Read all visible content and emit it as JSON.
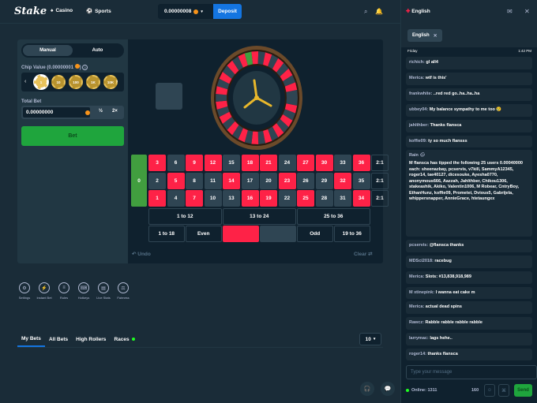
{
  "header": {
    "logo": "Stake",
    "nav": [
      {
        "label": "Casino",
        "icon": "casino-icon"
      },
      {
        "label": "Sports",
        "icon": "sports-icon"
      }
    ],
    "balance": "0.00000008",
    "deposit_label": "Deposit",
    "icons": [
      "search-icon",
      "bell-icon"
    ]
  },
  "game": {
    "tabs": [
      "Manual",
      "Auto"
    ],
    "chip_value_label": "Chip Value (0.00000001",
    "chip_value_info": "i",
    "chips": [
      "1",
      "10",
      "100",
      "1K",
      "10K"
    ],
    "total_bet_label": "Total Bet",
    "total_bet_value": "0.00000000",
    "half_label": "½",
    "double_label": "2×",
    "bet_button": "Bet",
    "undo_label": "Undo",
    "clear_label": "Clear",
    "zero": "0",
    "numbers_top": [
      {
        "n": "3",
        "c": "red"
      },
      {
        "n": "6",
        "c": "black"
      },
      {
        "n": "9",
        "c": "red"
      },
      {
        "n": "12",
        "c": "red"
      },
      {
        "n": "15",
        "c": "black"
      },
      {
        "n": "18",
        "c": "red"
      },
      {
        "n": "21",
        "c": "red"
      },
      {
        "n": "24",
        "c": "black"
      },
      {
        "n": "27",
        "c": "red"
      },
      {
        "n": "30",
        "c": "red"
      },
      {
        "n": "33",
        "c": "black"
      },
      {
        "n": "36",
        "c": "red"
      }
    ],
    "numbers_mid": [
      {
        "n": "2",
        "c": "black"
      },
      {
        "n": "5",
        "c": "red"
      },
      {
        "n": "8",
        "c": "black"
      },
      {
        "n": "11",
        "c": "black"
      },
      {
        "n": "14",
        "c": "red"
      },
      {
        "n": "17",
        "c": "black"
      },
      {
        "n": "20",
        "c": "black"
      },
      {
        "n": "23",
        "c": "red"
      },
      {
        "n": "26",
        "c": "black"
      },
      {
        "n": "29",
        "c": "black"
      },
      {
        "n": "32",
        "c": "red"
      },
      {
        "n": "35",
        "c": "black"
      }
    ],
    "numbers_bot": [
      {
        "n": "1",
        "c": "red"
      },
      {
        "n": "4",
        "c": "black"
      },
      {
        "n": "7",
        "c": "red"
      },
      {
        "n": "10",
        "c": "black"
      },
      {
        "n": "13",
        "c": "black"
      },
      {
        "n": "16",
        "c": "red"
      },
      {
        "n": "19",
        "c": "red"
      },
      {
        "n": "22",
        "c": "black"
      },
      {
        "n": "25",
        "c": "red"
      },
      {
        "n": "28",
        "c": "black"
      },
      {
        "n": "31",
        "c": "black"
      },
      {
        "n": "34",
        "c": "red"
      }
    ],
    "columns": [
      "2:1",
      "2:1",
      "2:1"
    ],
    "dozens": [
      "1 to 12",
      "13 to 24",
      "25 to 36"
    ],
    "outside": [
      "1 to 18",
      "Even",
      "",
      "",
      "Odd",
      "19 to 36"
    ]
  },
  "controls": [
    {
      "label": "Settings",
      "icon": "settings-icon"
    },
    {
      "label": "Instant Bet",
      "icon": "instant-bet-icon"
    },
    {
      "label": "Rules",
      "icon": "rules-icon"
    },
    {
      "label": "Hotkeys",
      "icon": "hotkeys-icon"
    },
    {
      "label": "Live Stats",
      "icon": "live-stats-icon"
    },
    {
      "label": "Fairness",
      "icon": "fairness-icon"
    }
  ],
  "bets": {
    "tabs": [
      "My Bets",
      "All Bets",
      "High Rollers",
      "Races"
    ],
    "page_size": "10"
  },
  "chat": {
    "language": "English",
    "room": "English",
    "day": "Friday",
    "time": "1:42 PM",
    "messages": [
      {
        "user": "richich:",
        "text": "gl all4"
      },
      {
        "user": "Merica:",
        "text": "wtf is this'"
      },
      {
        "user": "frankwhite:",
        "text": "..red red go..ha..ha..ha"
      },
      {
        "user": "ubbey04:",
        "text": "My balance sympathy to me too 😢"
      },
      {
        "user": "jahlthber:",
        "text": "Thanks flansca"
      },
      {
        "user": "koffie09:",
        "text": "ty so much flansss"
      },
      {
        "user": "Rain 🌧",
        "text": "M flansca has tipped the following 25 users 0.00040000 each: sheenazbay, pcservis, v7kill, SammyA12345, roger14, tae40127, dicesouke, Ayesha0770, anonymous666, Aazzah, Jahlthber, Chikou1306, stakeashik, Akiko, Valentin1006, M Robear, CntryBoy, EthanHunz, koffie09, Prometei, Dvious5, Gabrijela, whippersnapper, AnnieGrace, htetaungxx"
      },
      {
        "user": "pcservis:",
        "text": "@flansca thanks"
      },
      {
        "user": "MDSci2018:",
        "text": "racebug"
      },
      {
        "user": "Merica:",
        "text": "Slots: #13,838,918,989"
      },
      {
        "user": "M xtinepink:",
        "text": "I wanna eat cake m"
      },
      {
        "user": "Merica:",
        "text": "actual dead spins"
      },
      {
        "user": "Rawcz:",
        "text": "Rabble rabble rabble rabble"
      },
      {
        "user": "larrymac:",
        "text": "lags hehe.."
      },
      {
        "user": "roger14:",
        "text": "thanks flansca"
      }
    ],
    "input_placeholder": "Type your message",
    "online": "Online: 1311",
    "char_count": "160",
    "send_label": "Send"
  }
}
